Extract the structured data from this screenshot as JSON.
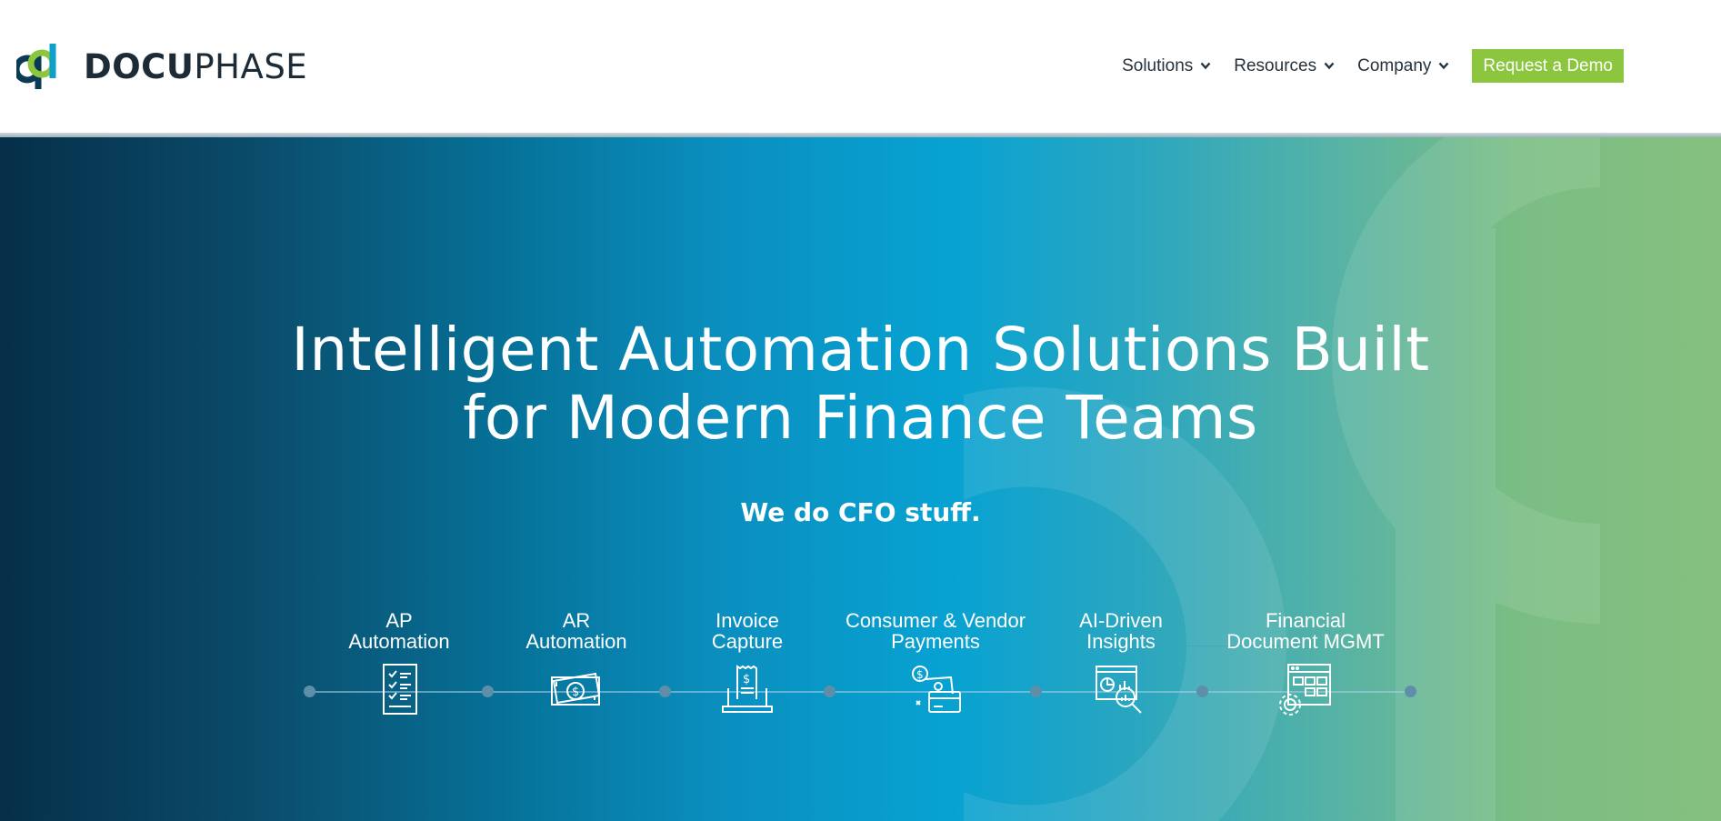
{
  "brand": {
    "logo_bold": "DOCU",
    "logo_light": "PHASE",
    "logo_icon": "docuphase-logo-mark"
  },
  "nav": {
    "items": [
      {
        "label": "Solutions",
        "icon": "chevron-down-icon"
      },
      {
        "label": "Resources",
        "icon": "chevron-down-icon"
      },
      {
        "label": "Company",
        "icon": "chevron-down-icon"
      }
    ],
    "cta_label": "Request a Demo"
  },
  "hero": {
    "headline_line1": "Intelligent Automation Solutions Built",
    "headline_line2": "for Modern Finance Teams",
    "tagline": "We do CFO stuff."
  },
  "solutions": [
    {
      "line1": "AP",
      "line2": "Automation",
      "icon": "checklist-document-icon"
    },
    {
      "line1": "AR",
      "line2": "Automation",
      "icon": "cash-bills-icon"
    },
    {
      "line1": "Invoice",
      "line2": "Capture",
      "icon": "laptop-invoice-icon"
    },
    {
      "line1": "Consumer & Vendor",
      "line2": "Payments",
      "icon": "card-payment-icon"
    },
    {
      "line1": "AI-Driven",
      "line2": "Insights",
      "icon": "analytics-magnifier-icon"
    },
    {
      "line1": "Financial",
      "line2": "Document MGMT",
      "icon": "document-gear-icon"
    }
  ],
  "colors": {
    "brand_green": "#8cc63f",
    "nav_text": "#25313b",
    "hero_dark": "#062f49",
    "hero_blue": "#07a2d2",
    "hero_green": "#86c07e"
  }
}
